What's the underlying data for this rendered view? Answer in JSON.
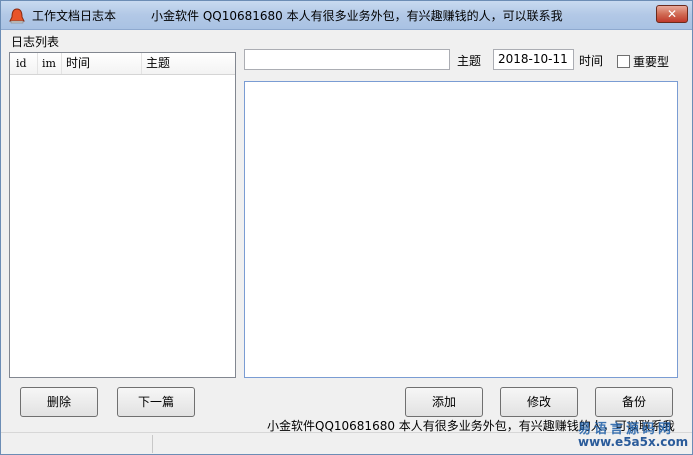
{
  "window": {
    "title": "工作文档日志本",
    "title_ad": "小金软件 QQ10681680 本人有很多业务外包，有兴趣赚钱的人，可以联系我",
    "close_glyph": "✕"
  },
  "log_list": {
    "label": "日志列表",
    "columns": [
      "id",
      "im",
      "时间",
      "主题"
    ],
    "rows": []
  },
  "editor": {
    "subject_value": "",
    "subject_label": "主题",
    "date_value": "2018-10-11",
    "time_label": "时间",
    "important_label": "重要型",
    "important_checked": false,
    "body_text": ""
  },
  "buttons": {
    "delete": "删除",
    "next": "下一篇",
    "add": "添加",
    "modify": "修改",
    "backup": "备份"
  },
  "footer": {
    "ad_text": "小金软件QQ10681680 本人有很多业务外包，有兴趣赚钱的人，可以联系我",
    "watermark_top": "易语言源码网",
    "watermark_bottom": "www.e5a5x.com"
  },
  "icons": {
    "app": "bell-icon"
  },
  "colors": {
    "titlebar": "#b2c8e6",
    "close_button": "#c0392b",
    "memo_border": "#7a9cd3",
    "watermark": "#1e5fa8"
  }
}
